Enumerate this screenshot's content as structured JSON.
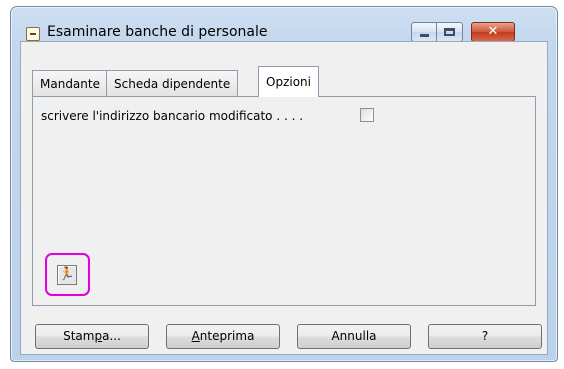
{
  "window": {
    "title": "Esaminare banche di personale",
    "close_glyph": "✕"
  },
  "tabs": [
    {
      "label": "Mandante",
      "active": false
    },
    {
      "label": "Scheda dipendente",
      "active": false
    },
    {
      "label": "Opzioni",
      "active": true
    }
  ],
  "options": {
    "modified_bank_address_label": "scrivere l'indirizzo bancario modificato  . . . .",
    "modified_bank_address_checked": false
  },
  "tool_button": {
    "icon": "running-figure-icon",
    "glyph": "🏃",
    "highlight_color": "#e000e0"
  },
  "buttons": {
    "print": {
      "before": "Stam",
      "underlined": "p",
      "after": "a..."
    },
    "preview": {
      "before": "",
      "underlined": "A",
      "after": "nteprima"
    },
    "cancel": {
      "label": "Annulla"
    },
    "help": {
      "label": "?"
    }
  },
  "colors": {
    "frame": "#c3d7ee",
    "close_button": "#c23b1d",
    "panel": "#f0f0f0"
  }
}
